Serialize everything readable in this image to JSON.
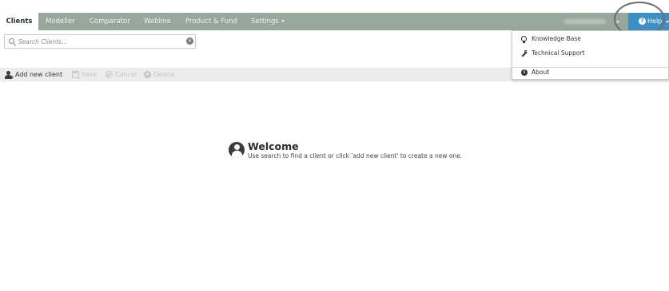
{
  "nav": {
    "tabs": [
      {
        "label": "Clients",
        "active": true
      },
      {
        "label": "Modeller",
        "active": false
      },
      {
        "label": "Comparator",
        "active": false
      },
      {
        "label": "Webline",
        "active": false
      },
      {
        "label": "Product & Fund",
        "active": false
      },
      {
        "label": "Settings",
        "active": false,
        "has_caret": true
      }
    ],
    "help_label": "Help",
    "help_icon": "question-circle-icon",
    "colors": {
      "navbar": "#98a79c",
      "help_button": "#3f8fc4",
      "highlight_ring": "#6e6e6e"
    }
  },
  "search": {
    "placeholder": "Search Clients...",
    "value": "",
    "icon": "search-icon",
    "clear_icon": "clear-icon"
  },
  "toolbar": {
    "add_label": "Add new client",
    "save_label": "Save",
    "cancel_label": "Cancel",
    "delete_label": "Delete"
  },
  "welcome": {
    "title": "Welcome",
    "subtitle": "Use search to find a client or click 'add new client' to create a new one."
  },
  "help_menu": {
    "items": [
      {
        "label": "Knowledge Base",
        "icon": "lightbulb-icon"
      },
      {
        "label": "Technical Support",
        "icon": "wrench-icon"
      },
      {
        "label": "About",
        "icon": "info-circle-icon"
      }
    ]
  }
}
